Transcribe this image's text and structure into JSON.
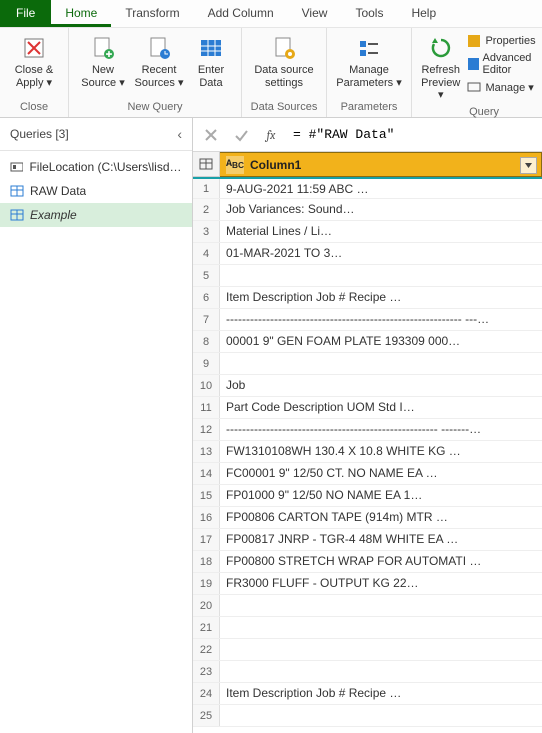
{
  "menu": {
    "file": "File",
    "home": "Home",
    "transform": "Transform",
    "addcol": "Add Column",
    "view": "View",
    "tools": "Tools",
    "help": "Help"
  },
  "ribbon": {
    "close_apply": "Close &\nApply ▾",
    "close_group": "Close",
    "new_source": "New\nSource ▾",
    "recent_sources": "Recent\nSources ▾",
    "enter_data": "Enter\nData",
    "new_query_group": "New Query",
    "data_source_settings": "Data source\nsettings",
    "data_sources_group": "Data Sources",
    "manage_params": "Manage\nParameters ▾",
    "parameters_group": "Parameters",
    "refresh_preview": "Refresh\nPreview ▾",
    "properties": "Properties",
    "advanced_editor": "Advanced Editor",
    "manage": "Manage ▾",
    "query_group": "Query"
  },
  "queries": {
    "title": "Queries [3]",
    "items": [
      {
        "label": "FileLocation (C:\\Users\\lisde…"
      },
      {
        "label": "RAW Data"
      },
      {
        "label": "Example"
      }
    ]
  },
  "formula": {
    "fx": "fx",
    "text": "= #\"RAW Data\""
  },
  "grid": {
    "column_type": "A B C",
    "column_name": "Column1",
    "rows": [
      "9-AUG-2021 11:59                                                ABC …",
      "                                                 Job Variances: Sound…",
      "                                                       Material Lines / Li…",
      "                                                      01-MAR-2021 TO 3…",
      "",
      "Item       Description                    Job #   Recipe           …",
      "-----------------------------------------------------------   ---…",
      "00001     9\" GEN FOAM PLATE           193309 000…",
      "",
      "                                                    Job",
      "        Part Code    Description                 UOM    Std I…",
      "        -----------------------------------------------------   -------…",
      "        FW1310108WH  130.4 X 10.8         WHITE KG  …",
      "        FC00001      9\" 12/50 CT. NO NAME      EA     …",
      "        FP01000      9\" 12/50 NO NAME           EA      1…",
      "        FP00806      CARTON TAPE (914m)     MTR   …",
      "        FP00817      JNRP - TGR-4 48M WHITE   EA    …",
      "        FP00800      STRETCH WRAP FOR AUTOMATI …",
      "        FR3000        FLUFF - OUTPUT               KG       22…",
      "",
      "",
      "",
      "",
      "Item       Description                    Job #   Recipe           …",
      ""
    ]
  }
}
